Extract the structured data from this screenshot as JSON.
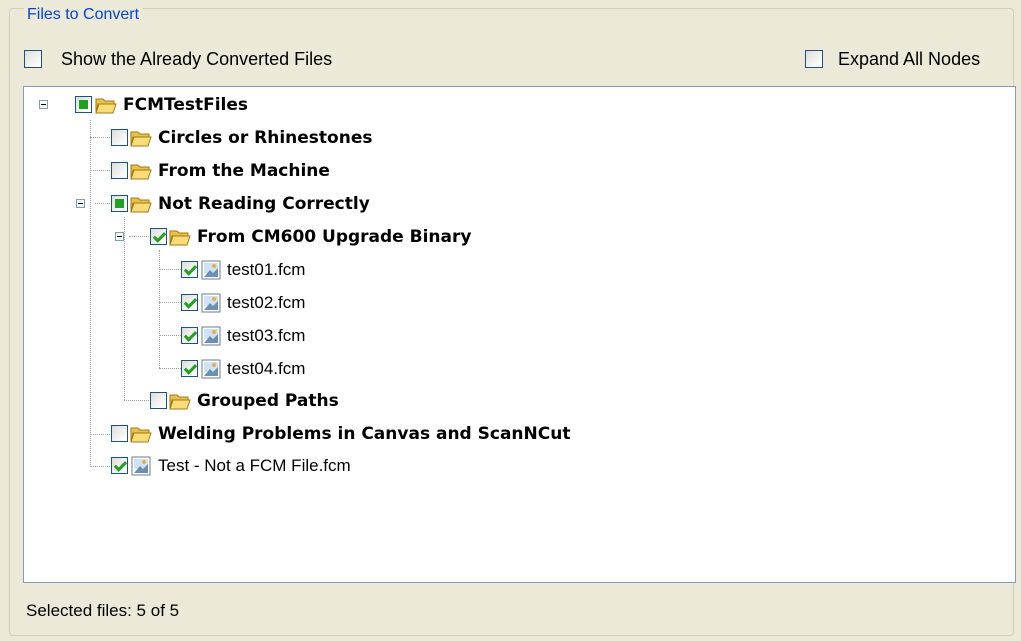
{
  "groupbox": {
    "title": "Files to Convert"
  },
  "options": {
    "show_converted_label": "Show the Already Converted Files",
    "show_converted_checked": false,
    "expand_all_label": "Expand All Nodes",
    "expand_all_checked": false
  },
  "tree": {
    "root": {
      "label": "FCMTestFiles",
      "state": "partial",
      "expanded": true
    },
    "circles": {
      "label": "Circles or Rhinestones",
      "state": "unchecked"
    },
    "machine": {
      "label": "From the Machine",
      "state": "unchecked"
    },
    "not_reading": {
      "label": "Not Reading Correctly",
      "state": "partial",
      "expanded": true
    },
    "cm600": {
      "label": "From CM600 Upgrade Binary",
      "state": "checked",
      "expanded": true
    },
    "files": [
      {
        "label": "test01.fcm",
        "state": "checked"
      },
      {
        "label": "test02.fcm",
        "state": "checked"
      },
      {
        "label": "test03.fcm",
        "state": "checked"
      },
      {
        "label": "test04.fcm",
        "state": "checked"
      }
    ],
    "grouped": {
      "label": "Grouped Paths",
      "state": "unchecked"
    },
    "welding": {
      "label": "Welding Problems in Canvas and ScanNCut",
      "state": "unchecked"
    },
    "test_file": {
      "label": "Test - Not a FCM File.fcm",
      "state": "checked"
    }
  },
  "status": {
    "text": "Selected files: 5 of 5"
  },
  "icons": {
    "folder": "folder-open-icon",
    "file": "image-file-icon"
  },
  "colors": {
    "check": "#21a121",
    "legend": "#0046d5",
    "folder": "#f5d66a"
  }
}
